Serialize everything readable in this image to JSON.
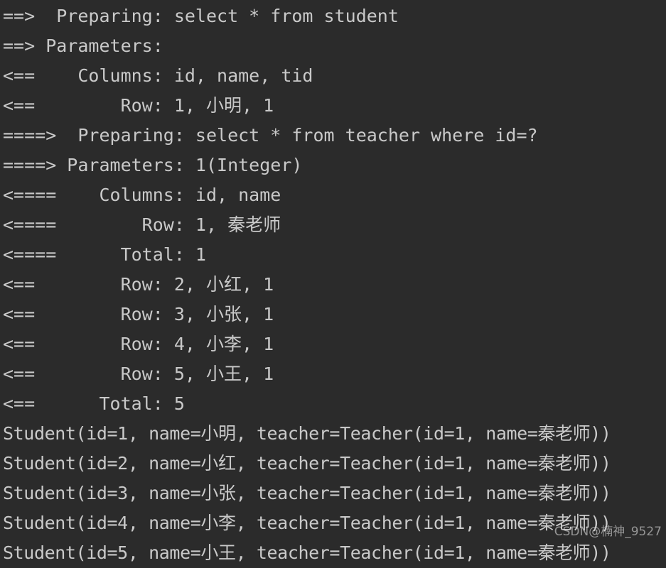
{
  "console": {
    "background_color": "#2b2b2b",
    "text_color": "#c9c9c9",
    "lines": [
      {
        "id": "prepare-student",
        "text": "==>  Preparing: select * from student"
      },
      {
        "id": "params-student",
        "text": "==> Parameters: "
      },
      {
        "id": "columns-student",
        "text": "<==    Columns: id, name, tid"
      },
      {
        "id": "row-student-1",
        "text": "<==        Row: 1, 小明, 1"
      },
      {
        "id": "prepare-teacher",
        "text": "====>  Preparing: select * from teacher where id=?"
      },
      {
        "id": "params-teacher",
        "text": "====> Parameters: 1(Integer)"
      },
      {
        "id": "columns-teacher",
        "text": "<====    Columns: id, name"
      },
      {
        "id": "row-teacher-1",
        "text": "<====        Row: 1, 秦老师"
      },
      {
        "id": "total-teacher",
        "text": "<====      Total: 1"
      },
      {
        "id": "row-student-2",
        "text": "<==        Row: 2, 小红, 1"
      },
      {
        "id": "row-student-3",
        "text": "<==        Row: 3, 小张, 1"
      },
      {
        "id": "row-student-4",
        "text": "<==        Row: 4, 小李, 1"
      },
      {
        "id": "row-student-5",
        "text": "<==        Row: 5, 小王, 1"
      },
      {
        "id": "total-student",
        "text": "<==      Total: 5"
      },
      {
        "id": "result-student-1",
        "text": "Student(id=1, name=小明, teacher=Teacher(id=1, name=秦老师))",
        "style": "result"
      },
      {
        "id": "result-student-2",
        "text": "Student(id=2, name=小红, teacher=Teacher(id=1, name=秦老师))",
        "style": "result"
      },
      {
        "id": "result-student-3",
        "text": "Student(id=3, name=小张, teacher=Teacher(id=1, name=秦老师))",
        "style": "result"
      },
      {
        "id": "result-student-4",
        "text": "Student(id=4, name=小李, teacher=Teacher(id=1, name=秦老师))",
        "style": "result"
      },
      {
        "id": "result-student-5",
        "text": "Student(id=5, name=小王, teacher=Teacher(id=1, name=秦老师))",
        "style": "result"
      }
    ]
  },
  "watermark": {
    "text": "CSDN@楠神_9527"
  }
}
